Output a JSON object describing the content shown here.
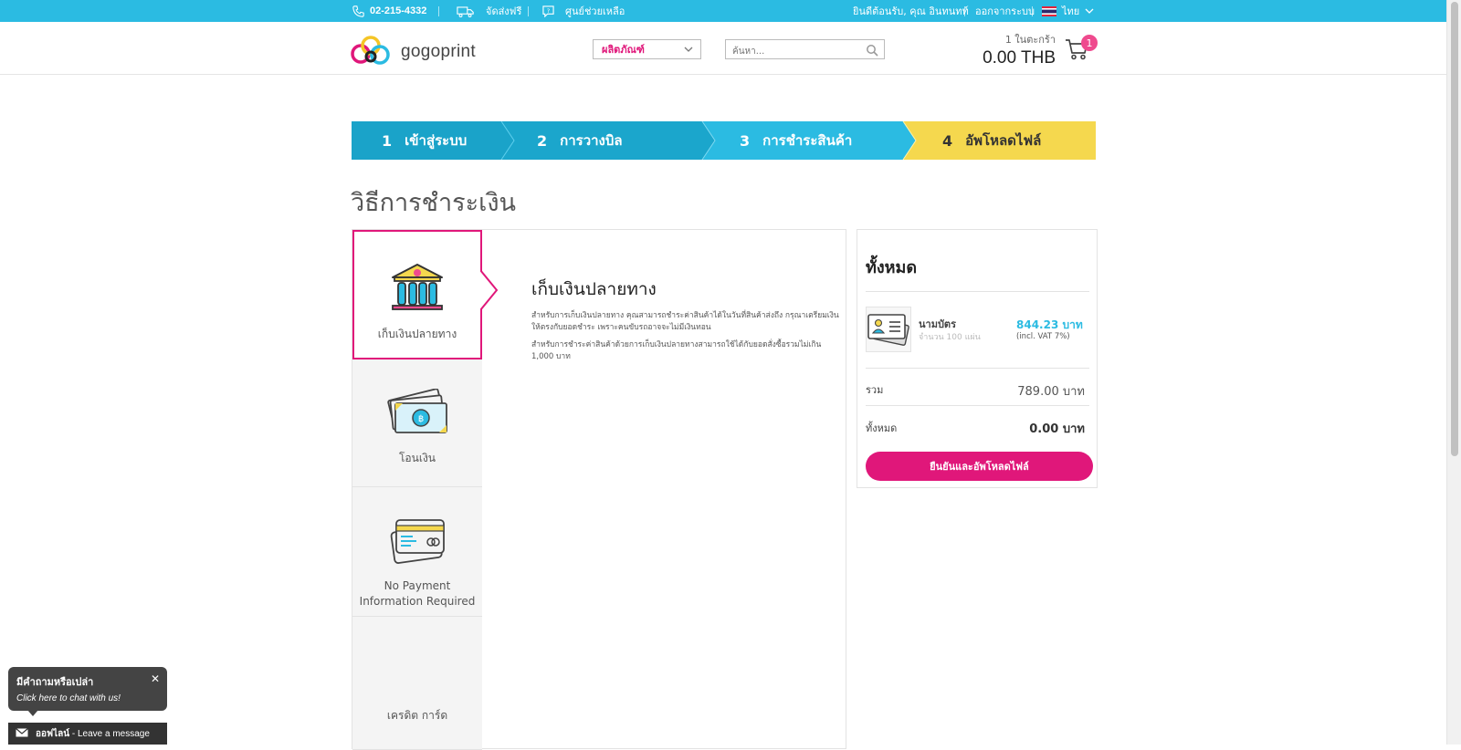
{
  "topbar": {
    "phone": "02-215-4332",
    "free_shipping": "จัดส่งฟรี",
    "help_center": "ศูนย์ช่วยเหลือ",
    "welcome": "ยินดีต้อนรับ, คุณ อินทนทท์",
    "logout": "ออกจากระบบ",
    "language": "ไทย"
  },
  "header": {
    "logo_text": "gogoprint",
    "product_select": "ผลิตภัณฑ์",
    "search_placeholder": "ค้นหา...",
    "cart_count_text": "1 ในตะกร้า",
    "cart_total": "0.00 THB",
    "cart_badge": "1"
  },
  "steps": [
    {
      "num": "1",
      "label": "เข้าสู่ระบบ"
    },
    {
      "num": "2",
      "label": "การวางบิล"
    },
    {
      "num": "3",
      "label": "การชำระสินค้า"
    },
    {
      "num": "4",
      "label": "อัพโหลดไฟล์"
    }
  ],
  "colors": {
    "step1": "#1aa3c9",
    "step2": "#1ba6cc",
    "step3": "#2bbbe2",
    "step4": "#f5d84e",
    "accent_pink": "#e0177a",
    "accent_blue": "#2bbbe2"
  },
  "page_title": "วิธีการชำระเงิน",
  "payment_methods": [
    {
      "label": "เก็บเงินปลายทาง",
      "icon": "bank-icon",
      "active": true
    },
    {
      "label": "โอนเงิน",
      "icon": "cash-icon",
      "active": false
    },
    {
      "label": "No Payment Information Required",
      "icon": "card-icon",
      "active": false
    },
    {
      "label": "เครดิต การ์ด",
      "icon": "credit-card-icon",
      "active": false
    }
  ],
  "method_detail": {
    "title": "เก็บเงินปลายทาง",
    "para1": "สำหรับการเก็บเงินปลายทาง คุณสามารถชำระค่าสินค้าได้ในวันที่สินค้าส่งถึง กรุณาเตรียมเงินให้ตรงกับยอดชำระ เพราะคนขับรถอาจจะไม่มีเงินทอน",
    "para2": "สำหรับการชำระค่าสินค้าด้วยการเก็บเงินปลายทางสามารถใช้ได้กับยอดสั่งซื้อรวมไม่เกิน 1,000 บาท"
  },
  "summary": {
    "title": "ทั้งหมด",
    "product_name": "นามบัตร",
    "product_sub": "จำนวน 100 แผ่น",
    "product_price": "844.23 บาท",
    "product_vat": "(incl. VAT 7%)",
    "subtotal_label": "รวม",
    "subtotal_value": "789.00 บาท",
    "total_label": "ทั้งหมด",
    "total_value": "0.00 บาท",
    "confirm_button": "ยืนยันและอัพโหลดไฟล์"
  },
  "chat": {
    "question": "มีคำถามหรือเปล่า",
    "cta": "Click here to chat with us!",
    "close": "✕",
    "offline_label": "ออฟไลน์",
    "offline_message": "- Leave a message"
  }
}
